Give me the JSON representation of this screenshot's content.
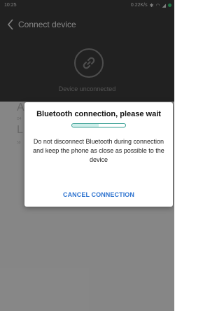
{
  "status_bar": {
    "time": "10:25",
    "right": "0.22K/s"
  },
  "header": {
    "title": "Connect device",
    "back_icon": "chevron-left-icon"
  },
  "device": {
    "status": "Device unconnected",
    "icon": "chain-link-icon"
  },
  "list": {
    "item_a": "A",
    "item_a_sub": "D4",
    "item_l": "L",
    "item_l_sub": "58"
  },
  "dialog": {
    "title": "Bluetooth connection, please wait",
    "progress": 0.5,
    "message": "Do not disconnect Bluetooth during connection and keep the phone as close as possible to the device",
    "button": "CANCEL CONNECTION"
  },
  "colors": {
    "accent": "#2f74d0",
    "progress": "#2d9a8e",
    "header_bg": "#3d3d3d"
  }
}
